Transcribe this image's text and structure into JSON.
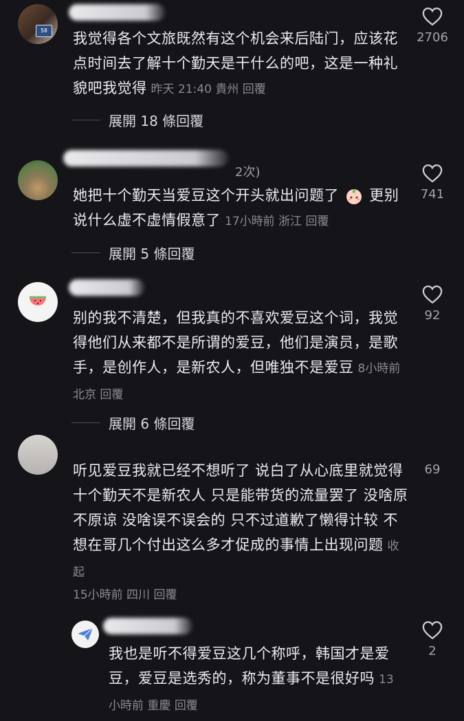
{
  "comments": [
    {
      "text": "我觉得各个文旅既然有这个机会来后陆门，应该花点时间去了解十个勤天是干什么的吧，这是一种礼貌吧我觉得",
      "time": "昨天 21:40",
      "location": "貴州",
      "reply_label": "回覆",
      "likes": "2706",
      "expand_label": "展開 18 條回覆",
      "avatar_text": "58"
    },
    {
      "user_suffix": "2次)",
      "text_before_emoji": "她把十个勤天当爱豆这个开头就出问题了",
      "text_after_emoji": "更别说什么虚不虚情假意了",
      "time": "17小時前",
      "location": "浙江",
      "reply_label": "回覆",
      "likes": "741",
      "expand_label": "展開 5 條回覆"
    },
    {
      "text": "别的我不清楚，但我真的不喜欢爱豆这个词，我觉得他们从来都不是所谓的爱豆，他们是演员，是歌手，是创作人，是新农人，但唯独不是爱豆",
      "time": "8小時前",
      "location": "北京",
      "reply_label": "回覆",
      "likes": "92",
      "expand_label": "展開 6 條回覆"
    },
    {
      "text": "听见爱豆我就已经不想听了 说白了从心底里就觉得十个勤天不是新农人 只是能带货的流量罢了 没啥原不原谅 没啥误不误会的 只不过道歉了懒得计较 不想在哥几个付出这么多才促成的事情上出现问题",
      "collapse_label": "收起",
      "time": "15小時前",
      "location": "四川",
      "reply_label": "回覆",
      "likes": "69"
    }
  ],
  "reply": {
    "text": "我也是听不得爱豆这几个称呼，韩国才是爱豆，爱豆是选秀的，称为董事不是很好吗",
    "time": "13小時前",
    "location": "重慶",
    "reply_label": "回覆",
    "likes": "2"
  }
}
